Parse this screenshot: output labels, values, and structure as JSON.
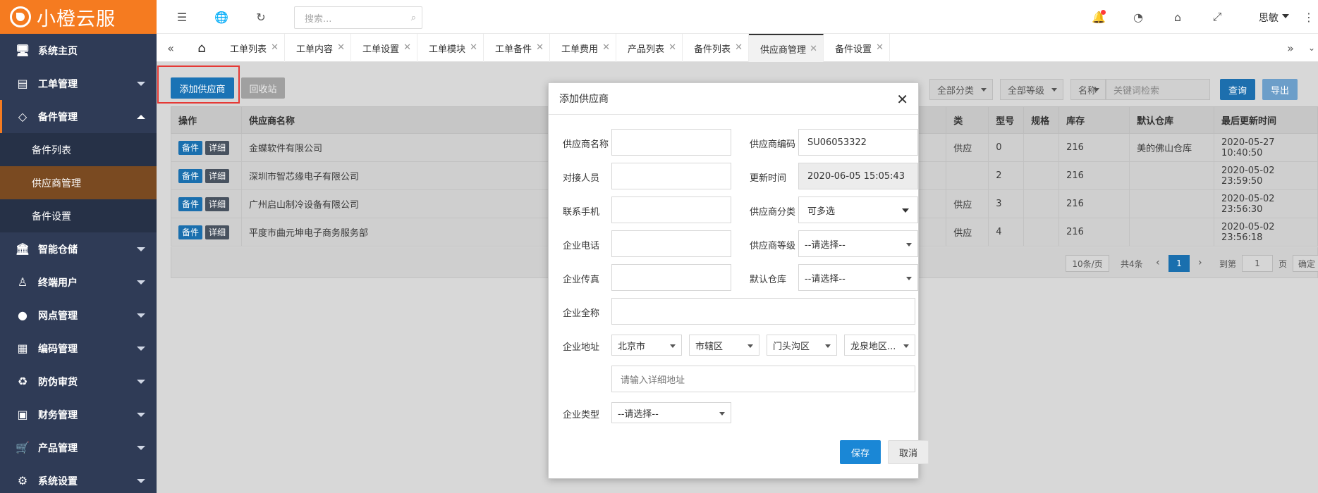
{
  "brand": {
    "name": "小橙云服"
  },
  "sidebar": {
    "items": [
      {
        "label": "系统主页"
      },
      {
        "label": "工单管理"
      },
      {
        "label": "备件管理"
      },
      {
        "label": "智能仓储"
      },
      {
        "label": "终端用户"
      },
      {
        "label": "网点管理"
      },
      {
        "label": "编码管理"
      },
      {
        "label": "防伪审货"
      },
      {
        "label": "财务管理"
      },
      {
        "label": "产品管理"
      },
      {
        "label": "系统设置"
      }
    ],
    "sub_items": [
      {
        "label": "备件列表"
      },
      {
        "label": "供应商管理"
      },
      {
        "label": "备件设置"
      }
    ]
  },
  "topbar": {
    "search_placeholder": "搜索...",
    "user_name": "思敏"
  },
  "tabs": [
    "工单列表",
    "工单内容",
    "工单设置",
    "工单模块",
    "工单备件",
    "工单费用",
    "产品列表",
    "备件列表",
    "供应商管理",
    "备件设置"
  ],
  "toolbar": {
    "add_label": "添加供应商",
    "recycle_label": "回收站",
    "filter_category": "全部分类",
    "filter_level": "全部等级",
    "filter_field": "名称",
    "keyword_placeholder": "关键词检索",
    "query_label": "查询",
    "export_label": "导出"
  },
  "table": {
    "headers": {
      "op": "操作",
      "name": "供应商名称",
      "type": "类",
      "model": "型号",
      "spec": "规格",
      "stock": "库存",
      "warehouse": "默认仓库",
      "updated": "最后更新时间"
    },
    "op_btn1": "备件",
    "op_btn2": "详细",
    "rows": [
      {
        "name": "金蝶软件有限公司",
        "type": "供应",
        "model": "0",
        "spec": "",
        "stock": "216",
        "warehouse": "美的佛山仓库",
        "updated": "2020-05-27 10:40:50"
      },
      {
        "name": "深圳市智芯缘电子有限公司",
        "type": "",
        "model": "2",
        "spec": "",
        "stock": "216",
        "warehouse": "",
        "updated": "2020-05-02 23:59:50"
      },
      {
        "name": "广州启山制冷设备有限公司",
        "type": "供应",
        "model": "3",
        "spec": "",
        "stock": "216",
        "warehouse": "",
        "updated": "2020-05-02 23:56:30"
      },
      {
        "name": "平度市曲元坤电子商务服务部",
        "type": "供应",
        "model": "4",
        "spec": "",
        "stock": "216",
        "warehouse": "",
        "updated": "2020-05-02 23:56:18"
      }
    ]
  },
  "pager": {
    "per_page": "10条/页",
    "total": "共4条",
    "current": "1",
    "goto_label": "到第",
    "goto_value": "1",
    "page_unit": "页",
    "confirm": "确定"
  },
  "modal": {
    "title": "添加供应商",
    "fields": {
      "name_label": "供应商名称",
      "code_label": "供应商编码",
      "code_value": "SU06053322",
      "contact_label": "对接人员",
      "time_label": "更新时间",
      "time_value": "2020-06-05 15:05:43",
      "phone_label": "联系手机",
      "category_label": "供应商分类",
      "category_value": "可多选",
      "tel_label": "企业电话",
      "level_label": "供应商等级",
      "level_value": "--请选择--",
      "fax_label": "企业传真",
      "warehouse_label": "默认仓库",
      "warehouse_value": "--请选择--",
      "fullname_label": "企业全称",
      "address_label": "企业地址",
      "province": "北京市",
      "city": "市辖区",
      "district": "门头沟区",
      "area": "龙泉地区...",
      "detail_placeholder": "请输入详细地址",
      "type_label": "企业类型",
      "type_value": "--请选择--"
    },
    "save_label": "保存",
    "cancel_label": "取消"
  },
  "colors": {
    "brand_orange": "#f57b20",
    "sidebar_bg": "#2f3b56",
    "primary_blue": "#1a73b5",
    "red_highlight": "#e53935"
  }
}
